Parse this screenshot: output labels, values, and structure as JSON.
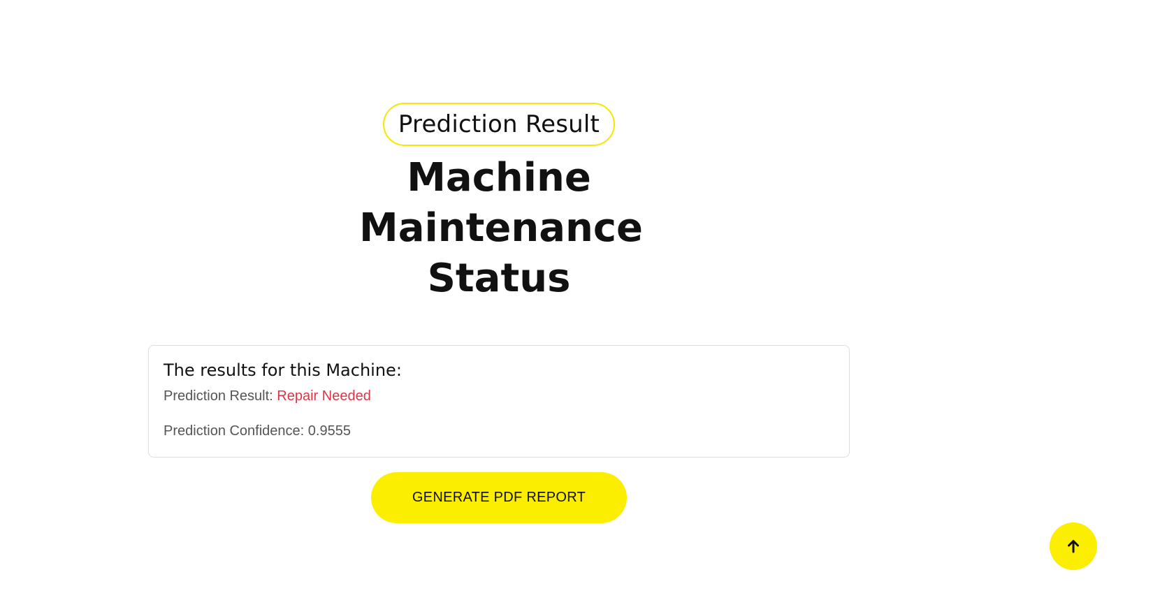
{
  "hero": {
    "eyebrow": "Prediction Result",
    "title_line_1": "Machine",
    "title_line_2": "Maintenance",
    "title_line_3": "Status"
  },
  "results": {
    "heading": "The results for this Machine:",
    "prediction_label": "Prediction Result: ",
    "prediction_value": "Repair Needed",
    "confidence_label": "Prediction Confidence: ",
    "confidence_value": "0.9555"
  },
  "actions": {
    "generate_pdf_label": "GENERATE PDF REPORT"
  },
  "scroll_top": {
    "icon": "arrow-up-icon"
  },
  "colors": {
    "accent_yellow": "#fcee00",
    "danger_red": "#dc3545",
    "text_dark": "#111111",
    "text_muted": "#555555",
    "card_border": "#dedede"
  }
}
